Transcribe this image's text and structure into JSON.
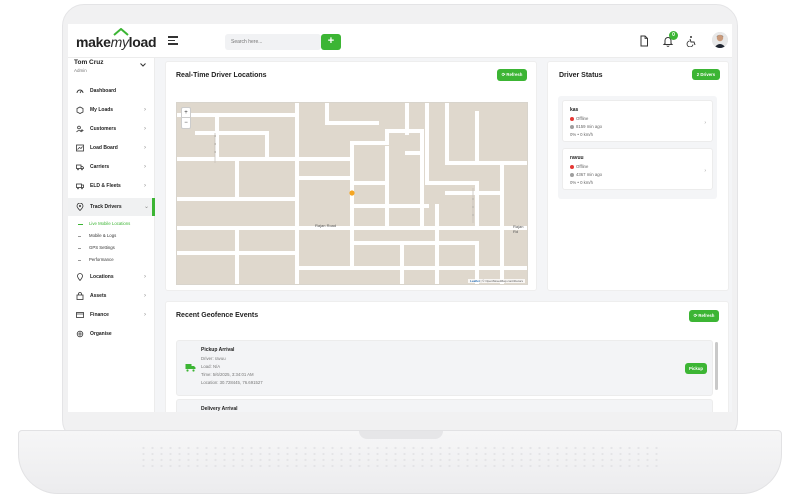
{
  "app": {
    "logo_make": "make",
    "logo_my": "my",
    "logo_load": "load"
  },
  "topbar": {
    "search_placeholder": "Search here...",
    "search_button": "+",
    "notification_count": "0"
  },
  "user": {
    "name": "Tom Cruz",
    "role": "Admin"
  },
  "sidebar": {
    "items": [
      {
        "label": "Dashboard",
        "icon": "dashboard-icon"
      },
      {
        "label": "My Loads",
        "icon": "box-icon"
      },
      {
        "label": "Customers",
        "icon": "users-icon"
      },
      {
        "label": "Load Board",
        "icon": "chart-icon"
      },
      {
        "label": "Carriers",
        "icon": "truck-icon"
      },
      {
        "label": "ELD & Fleets",
        "icon": "fleet-icon"
      },
      {
        "label": "Track Drivers",
        "icon": "pin-icon"
      },
      {
        "label": "Locations",
        "icon": "location-icon"
      },
      {
        "label": "Assets",
        "icon": "bag-icon"
      },
      {
        "label": "Finance",
        "icon": "finance-icon"
      },
      {
        "label": "Organise",
        "icon": "gear-icon"
      }
    ],
    "sub_items": [
      "Live Mobile Locations",
      "Mobile & Logs",
      "GPS Settings",
      "Performance"
    ]
  },
  "map_card": {
    "title": "Real-Time Driver Locations",
    "refresh": "⟳ Refresh",
    "road_label_1": "Rajan Road",
    "road_label_2": "Rajan Rd",
    "zoom_in": "+",
    "zoom_out": "−",
    "attribution_leaflet": "Leaflet",
    "attribution_rest": "| © OpenStreetMap contributors"
  },
  "status_card": {
    "title": "Driver Status",
    "badge": "2 Drivers",
    "drivers": [
      {
        "name": "kas",
        "status": "Offline",
        "ago": "8159 min ago",
        "meta": "0% • 0 km/h"
      },
      {
        "name": "ravuu",
        "status": "Offline",
        "ago": "4367 min ago",
        "meta": "0% • 0 km/h"
      }
    ]
  },
  "geofence_card": {
    "title": "Recent Geofence Events",
    "refresh": "⟳ Refresh",
    "events": [
      {
        "title": "Pickup Arrival",
        "driver": "Driver: ravuu",
        "load": "Load: N/A",
        "time": "Time: 5/6/2025, 3:34:01 AM",
        "location": "Location: 30.728445, 76.691527",
        "tag": "Pickup"
      },
      {
        "title": "Delivery Arrival"
      }
    ]
  },
  "colors": {
    "accent": "#3cb534",
    "offline": "#e53935",
    "marker": "#f5a623"
  }
}
